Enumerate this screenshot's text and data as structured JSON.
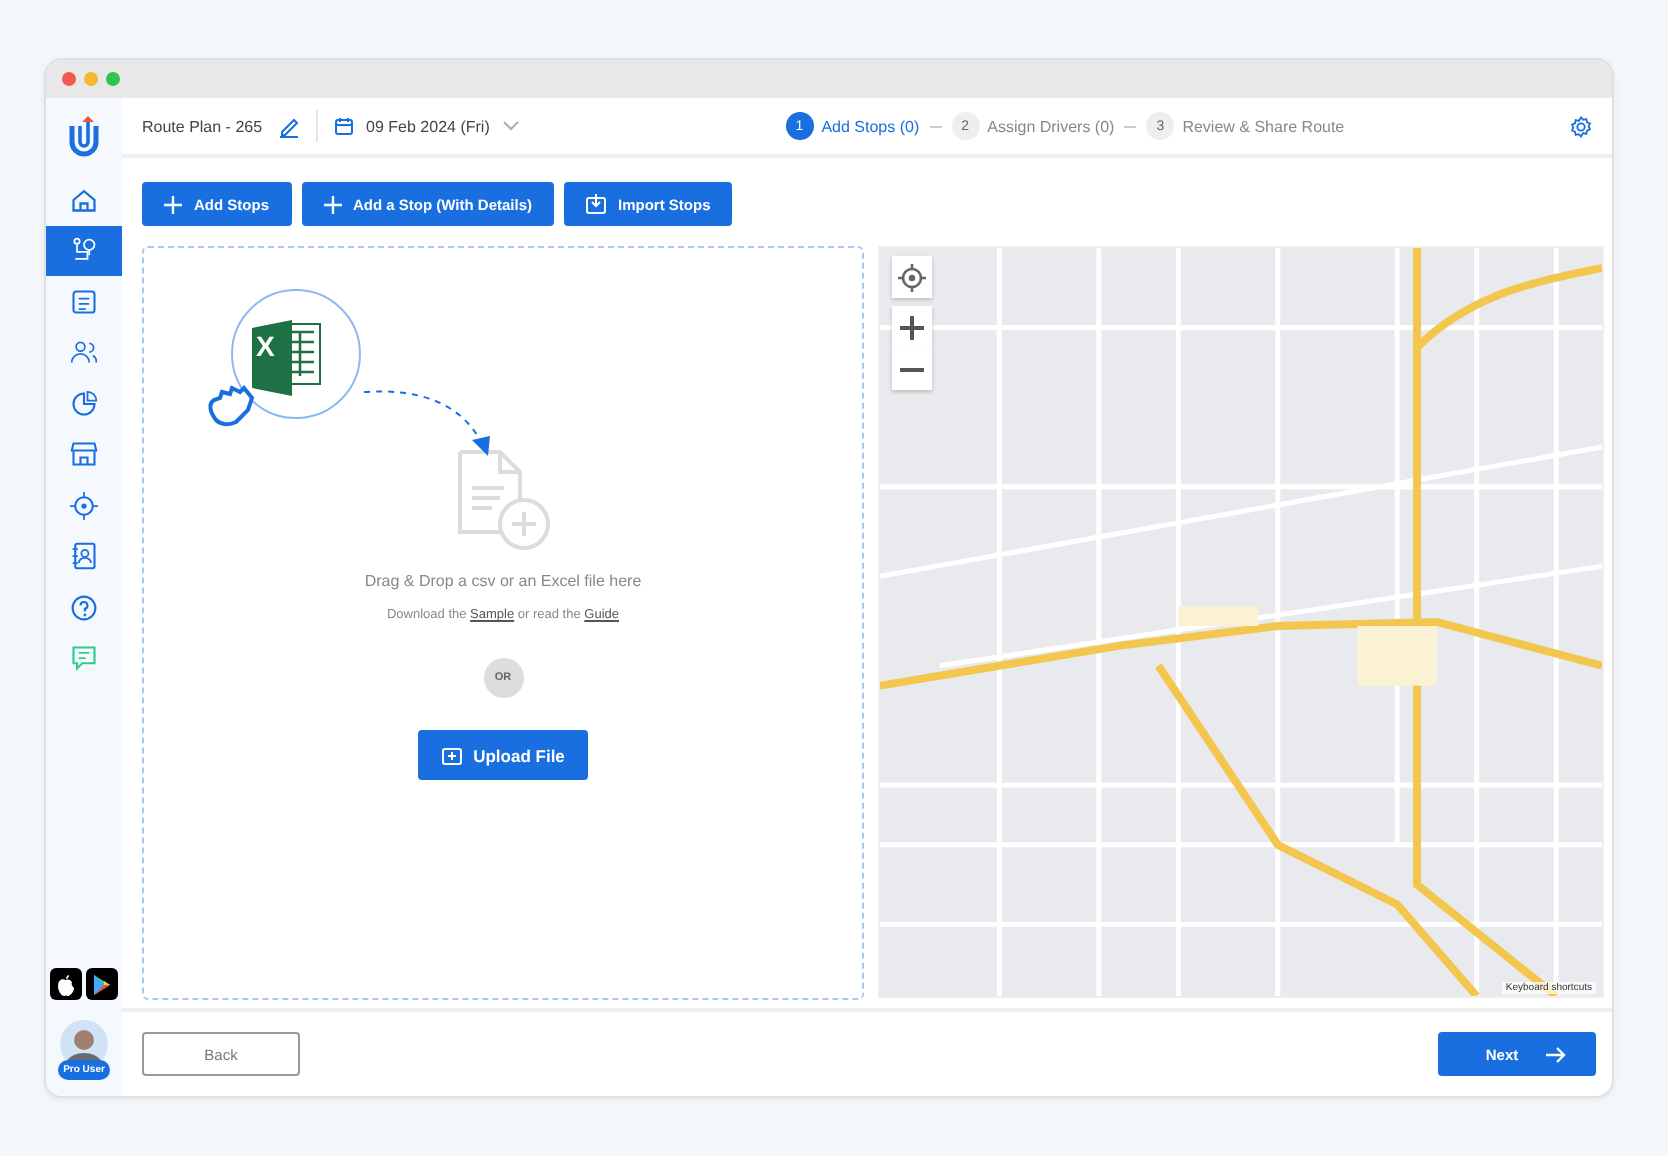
{
  "sidebar": {
    "items": [
      {
        "kind": "home",
        "selected": false
      },
      {
        "kind": "route",
        "selected": true
      },
      {
        "kind": "list",
        "selected": false
      },
      {
        "kind": "users",
        "selected": false
      },
      {
        "kind": "chart",
        "selected": false
      },
      {
        "kind": "store",
        "selected": false
      },
      {
        "kind": "target",
        "selected": false
      },
      {
        "kind": "contact",
        "selected": false
      },
      {
        "kind": "help",
        "selected": false
      },
      {
        "kind": "chat",
        "selected": false
      }
    ],
    "user_badge": "Pro User"
  },
  "header": {
    "plan_title": "Route Plan - 265",
    "date": "09 Feb 2024 (Fri)",
    "steps": [
      {
        "number": "1",
        "label": "Add Stops (0)",
        "selected": true
      },
      {
        "number": "2",
        "label": "Assign Drivers (0)",
        "selected": false
      },
      {
        "number": "3",
        "label": "Review & Share Route",
        "selected": false
      }
    ]
  },
  "toolbar": {
    "buttons": [
      {
        "kind": "plus",
        "label": "Add Stops"
      },
      {
        "kind": "plus",
        "label": "Add a Stop (With Details)"
      },
      {
        "kind": "import",
        "label": "Import Stops"
      }
    ]
  },
  "upload": {
    "excel_letter": "X",
    "instruction": "Drag & Drop a csv or an Excel file here",
    "help": [
      {
        "kind": "text",
        "text": "Download the"
      },
      {
        "kind": "link",
        "text": "Sample"
      },
      {
        "kind": "text",
        "text": "or read the"
      },
      {
        "kind": "link",
        "text": "Guide"
      }
    ],
    "separator": "OR",
    "button": "Upload File"
  },
  "map": {
    "attribution": "Keyboard shortcuts"
  },
  "footer": {
    "back": "Back",
    "next": "Next"
  }
}
